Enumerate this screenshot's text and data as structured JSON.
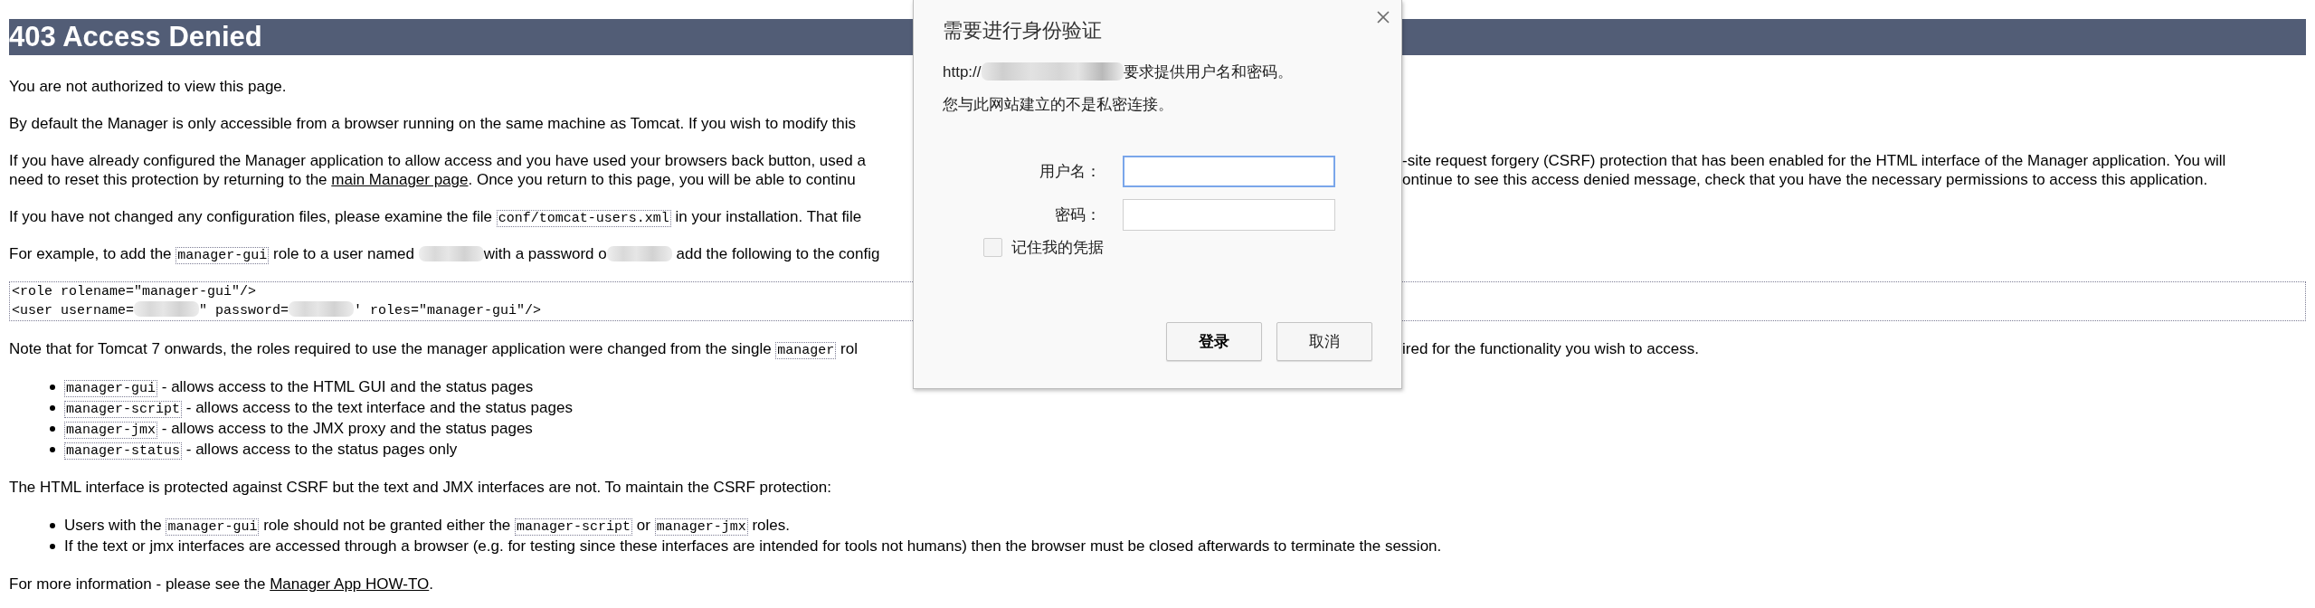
{
  "heading": "403 Access Denied",
  "content": [
    {
      "kind": "paragraph",
      "left": [
        [
          {
            "kind": "text",
            "text": "You are not authorized to view this page."
          }
        ]
      ]
    },
    {
      "kind": "paragraph",
      "left": [
        [
          {
            "kind": "text",
            "text": "By default the Manager is only accessible from a browser running on the same machine as Tomcat. If you wish to modify this"
          }
        ]
      ]
    },
    {
      "kind": "paragraph",
      "left": [
        [
          {
            "kind": "text",
            "text": "If you have already configured the Manager application to allow access and you have used your browsers back button, used a"
          }
        ],
        [
          {
            "kind": "text",
            "text": "need to reset this protection by returning to the "
          },
          {
            "kind": "link",
            "text": "main Manager page"
          },
          {
            "kind": "text",
            "text": ". Once you return to this page, you will be able to continu"
          }
        ]
      ],
      "right": [
        [
          {
            "kind": "text",
            "text": "-site request forgery (CSRF) protection that has been enabled for the HTML interface of the Manager application. You will"
          }
        ],
        [
          {
            "kind": "text",
            "text": "ontinue to see this access denied message, check that you have the necessary permissions to access this application."
          }
        ]
      ]
    },
    {
      "kind": "paragraph",
      "left": [
        [
          {
            "kind": "text",
            "text": "If you have not changed any configuration files, please examine the file "
          },
          {
            "kind": "code",
            "text": "conf/tomcat-users.xml"
          },
          {
            "kind": "text",
            "text": " in your installation. That file"
          }
        ]
      ]
    },
    {
      "kind": "paragraph",
      "left": [
        [
          {
            "kind": "text",
            "text": "For example, to add the "
          },
          {
            "kind": "code",
            "text": "manager-gui"
          },
          {
            "kind": "text",
            "text": " role to a user named "
          },
          {
            "kind": "redacted"
          },
          {
            "kind": "text",
            "text": "with a password o"
          },
          {
            "kind": "redacted"
          },
          {
            "kind": "text",
            "text": " add the following to the config"
          }
        ]
      ]
    },
    {
      "kind": "code_block",
      "lines": [
        [
          {
            "kind": "text",
            "text": "<role rolename=\"manager-gui\"/>"
          }
        ],
        [
          {
            "kind": "text",
            "text": "<user username="
          },
          {
            "kind": "redacted"
          },
          {
            "kind": "text",
            "text": "\" password="
          },
          {
            "kind": "redacted"
          },
          {
            "kind": "text",
            "text": "' roles=\"manager-gui\"/>"
          }
        ]
      ]
    },
    {
      "kind": "paragraph",
      "left": [
        [
          {
            "kind": "text",
            "text": "Note that for Tomcat 7 onwards, the roles required to use the manager application were changed from the single "
          },
          {
            "kind": "code",
            "text": "manager"
          },
          {
            "kind": "text",
            "text": " rol"
          }
        ]
      ],
      "right": [
        [
          {
            "kind": "text",
            "text": "ired for the functionality you wish to access."
          }
        ]
      ]
    },
    {
      "kind": "list",
      "items": [
        [
          {
            "kind": "code",
            "text": "manager-gui"
          },
          {
            "kind": "text",
            "text": " - allows access to the HTML GUI and the status pages"
          }
        ],
        [
          {
            "kind": "code",
            "text": "manager-script"
          },
          {
            "kind": "text",
            "text": " - allows access to the text interface and the status pages"
          }
        ],
        [
          {
            "kind": "code",
            "text": "manager-jmx"
          },
          {
            "kind": "text",
            "text": " - allows access to the JMX proxy and the status pages"
          }
        ],
        [
          {
            "kind": "code",
            "text": "manager-status"
          },
          {
            "kind": "text",
            "text": " - allows access to the status pages only"
          }
        ]
      ]
    },
    {
      "kind": "paragraph",
      "left": [
        [
          {
            "kind": "text",
            "text": "The HTML interface is protected against CSRF but the text and JMX interfaces are not. To maintain the CSRF protection:"
          }
        ]
      ]
    },
    {
      "kind": "list",
      "items": [
        [
          {
            "kind": "text",
            "text": "Users with the "
          },
          {
            "kind": "code",
            "text": "manager-gui"
          },
          {
            "kind": "text",
            "text": " role should not be granted either the "
          },
          {
            "kind": "code",
            "text": "manager-script"
          },
          {
            "kind": "text",
            "text": " or "
          },
          {
            "kind": "code",
            "text": "manager-jmx"
          },
          {
            "kind": "text",
            "text": " roles."
          }
        ],
        [
          {
            "kind": "text",
            "text": "If the text or jmx interfaces are accessed through a browser (e.g. for testing since these interfaces are intended for tools not humans) then the browser must be closed afterwards to terminate the session."
          }
        ]
      ]
    },
    {
      "kind": "paragraph",
      "left": [
        [
          {
            "kind": "text",
            "text": "For more information - please see the "
          },
          {
            "kind": "link",
            "text": "Manager App HOW-TO"
          },
          {
            "kind": "text",
            "text": "."
          }
        ]
      ]
    }
  ],
  "dialog": {
    "title": "需要进行身份验证",
    "message_lines": [
      [
        {
          "kind": "text",
          "text": "http://"
        },
        {
          "kind": "redacted"
        },
        {
          "kind": "text",
          "text": "要求提供用户名和密码。"
        }
      ],
      [
        {
          "kind": "text",
          "text": "您与此网站建立的不是私密连接。"
        }
      ]
    ],
    "fields": [
      {
        "label": "用户名：",
        "focused": true
      },
      {
        "label": "密码：",
        "focused": false
      }
    ],
    "remember": {
      "label": "记住我的凭据",
      "checked": false
    },
    "buttons": [
      {
        "label": "登录",
        "default": true
      },
      {
        "label": "取消",
        "default": false
      }
    ]
  }
}
